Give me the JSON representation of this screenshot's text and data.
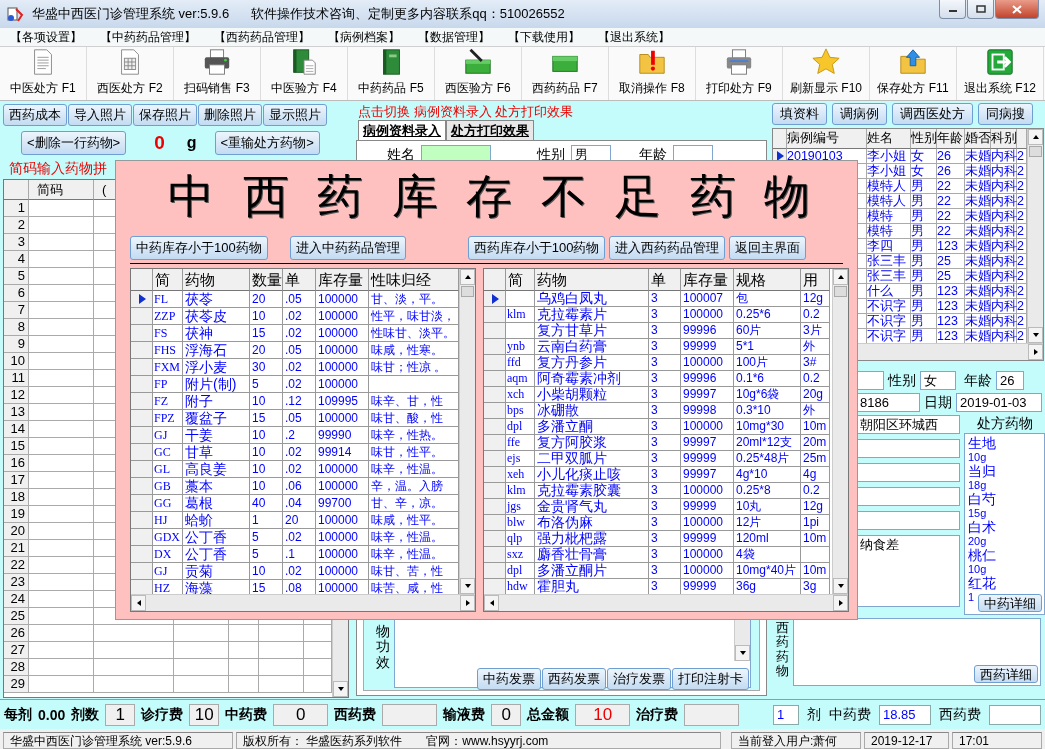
{
  "window": {
    "title": "华盛中西医门诊管理系统 ver:5.9.6",
    "subtitle": "软件操作技术咨询、定制更多内容联系qq：510026552"
  },
  "menu": [
    "【各项设置】",
    "【中药药品管理】",
    "【西药药品管理】",
    "【病例档案】",
    "【数据管理】",
    "【下载使用】",
    "【退出系统】"
  ],
  "toolbar": [
    "中医处方 F1",
    "西医处方 F2",
    "扫码销售 F3",
    "中医验方 F4",
    "中药药品 F5",
    "西医验方 F6",
    "西药药品 F7",
    "取消操作 F8",
    "打印处方 F9",
    "刷新显示 F10",
    "保存处方 F11",
    "退出系统 F12"
  ],
  "left_panel": {
    "photo_buttons": [
      "西药成本",
      "导入照片",
      "保存照片",
      "删除照片",
      "显示照片"
    ],
    "delete_row_button": "<删除一行药物>",
    "weight": "0",
    "weight_unit": "g",
    "reset_button": "<重输处方药物>",
    "hint": "简码输入药物拼",
    "grid": {
      "columns": [
        "简码",
        "("
      ],
      "row_numbers": [
        "1",
        "2",
        "3",
        "4",
        "5",
        "6",
        "7",
        "8",
        "9",
        "10",
        "11",
        "12",
        "13",
        "14",
        "15",
        "16",
        "17",
        "18",
        "19",
        "20",
        "21",
        "22",
        "23",
        "24",
        "25",
        "26",
        "27",
        "28",
        "29"
      ]
    }
  },
  "center_panel": {
    "switch_hint": "点击切换  病例资料录入  处方打印效果",
    "tabs": [
      {
        "label": "病例资料录入",
        "selected": true
      },
      {
        "label": "处方打印效果",
        "selected": false
      }
    ],
    "form": {
      "name_label": "姓名",
      "sex_label": "性别",
      "sex": "男",
      "age_label": "年龄"
    },
    "effect_label": "物功效",
    "invoice_buttons": [
      "中药发票",
      "西药发票",
      "治疗发票",
      "打印注射卡"
    ]
  },
  "right_panel": {
    "buttons": [
      "填资料",
      "调病例",
      "调西医处方",
      "同病搜"
    ],
    "cases": {
      "columns": [
        "病例编号",
        "姓名",
        "性别",
        "年龄",
        "婚否",
        "科别"
      ],
      "rows": [
        {
          "id": "20190103",
          "name": "李小姐",
          "sex": "女",
          "age": "26",
          "marital": "未婚",
          "dept": "内科",
          "column_7": "2",
          "selected": true
        },
        {
          "name": "李小姐",
          "sex": "女",
          "age": "26",
          "marital": "未婚",
          "dept": "内科",
          "column_7": "2"
        },
        {
          "name": "模特人",
          "sex": "男",
          "age": "22",
          "marital": "未婚",
          "dept": "内科",
          "column_7": "2"
        },
        {
          "name": "模特人",
          "sex": "男",
          "age": "22",
          "marital": "未婚",
          "dept": "内科",
          "column_7": "2"
        },
        {
          "name": "模特",
          "sex": "男",
          "age": "22",
          "marital": "未婚",
          "dept": "内科",
          "column_7": "2"
        },
        {
          "name": "模特",
          "sex": "男",
          "age": "22",
          "marital": "未婚",
          "dept": "内科",
          "column_7": "2"
        },
        {
          "name": "李四",
          "sex": "男",
          "age": "123",
          "marital": "未婚",
          "dept": "内科",
          "column_7": "2"
        },
        {
          "name": "张三丰",
          "sex": "男",
          "age": "25",
          "marital": "未婚",
          "dept": "内科",
          "column_7": "2"
        },
        {
          "name": "张三丰",
          "sex": "男",
          "age": "25",
          "marital": "未婚",
          "dept": "内科",
          "column_7": "2"
        },
        {
          "name": "什么",
          "sex": "男",
          "age": "123",
          "marital": "未婚",
          "dept": "内科",
          "column_7": "2"
        },
        {
          "name": "不识字",
          "sex": "男",
          "age": "123",
          "marital": "未婚",
          "dept": "内科",
          "column_7": "2"
        },
        {
          "name": "不识字",
          "sex": "男",
          "age": "123",
          "marital": "未婚",
          "dept": "内科",
          "column_7": "2"
        },
        {
          "name": "不识字",
          "sex": "男",
          "age": "123",
          "marital": "未婚",
          "dept": "内科",
          "column_7": "2"
        }
      ]
    },
    "form": {
      "sex_label": "性别",
      "sex": "女",
      "age_label": "年龄",
      "age": "26",
      "phone": "8186",
      "date_label": "日期",
      "date": "2019-01-03",
      "address": "朝阳区环城西",
      "complaint": "纳食差"
    },
    "prescription": {
      "title": "处方药物",
      "items": [
        {
          "name": "生地",
          "dose": "10g"
        },
        {
          "name": "当归",
          "dose": "18g"
        },
        {
          "name": "白芍",
          "dose": "15g"
        },
        {
          "name": "白术",
          "dose": "20g"
        },
        {
          "name": "桃仁",
          "dose": "10g"
        },
        {
          "name": "红花",
          "dose": "1"
        }
      ],
      "detail_button": "中药详细"
    },
    "western": {
      "label": "西药药物",
      "detail_button": "西药详细"
    }
  },
  "stock_dialog": {
    "title": "中西药库存不足药物",
    "buttons": [
      "中药库存小于100药物",
      "进入中药药品管理",
      "西药库存小于100药物",
      "进入西药药品管理",
      "返回主界面"
    ],
    "herbal_grid": {
      "columns": [
        "简",
        "药物",
        "数量",
        "单",
        "库存量",
        "性味归经"
      ],
      "rows": [
        {
          "code": "FL",
          "name": "茯苓",
          "qty": "20",
          "price": ".05",
          "stock": "100000",
          "properties": "甘、淡，平。",
          "selected": true
        },
        {
          "code": "ZZP",
          "name": "茯苓皮",
          "qty": "10",
          "price": ".02",
          "stock": "100000",
          "properties": "性平，味甘淡，",
          "selected": false
        },
        {
          "code": "FS",
          "name": "茯神",
          "qty": "15",
          "price": ".02",
          "stock": "100000",
          "properties": "性味甘、淡平。",
          "selected": false
        },
        {
          "code": "FHS",
          "name": "浮海石",
          "qty": "20",
          "price": ".05",
          "stock": "100000",
          "properties": "味咸，性寒。",
          "selected": false
        },
        {
          "code": "FXM",
          "name": "浮小麦",
          "qty": "30",
          "price": ".02",
          "stock": "100000",
          "properties": "味甘；性凉 。",
          "selected": false
        },
        {
          "code": "FP",
          "name": "附片(制)",
          "qty": "5",
          "price": ".02",
          "stock": "100000",
          "selected": false
        },
        {
          "code": "FZ",
          "name": "附子",
          "qty": "10",
          "price": ".12",
          "stock": "109995",
          "properties": "味辛、甘，性",
          "selected": false
        },
        {
          "code": "FPZ",
          "name": "覆盆子",
          "qty": "15",
          "price": ".05",
          "stock": "100000",
          "properties": "味甘、酸，性",
          "selected": false
        },
        {
          "code": "GJ",
          "name": "干姜",
          "qty": "10",
          "price": ".2",
          "stock": "99990",
          "properties": "味辛，性热。",
          "selected": false
        },
        {
          "code": "GC",
          "name": "甘草",
          "qty": "10",
          "price": ".02",
          "stock": "99914",
          "properties": "味甘，性平。",
          "selected": false
        },
        {
          "code": "GL",
          "name": "高良姜",
          "qty": "10",
          "price": ".02",
          "stock": "100000",
          "properties": "味辛，性温。",
          "selected": false
        },
        {
          "code": "GB",
          "name": "藁本",
          "qty": "10",
          "price": ".06",
          "stock": "100000",
          "properties": "辛，温。入膀",
          "selected": false
        },
        {
          "code": "GG",
          "name": "葛根",
          "qty": "40",
          "price": ".04",
          "stock": "99700",
          "properties": "甘、辛，凉。",
          "selected": false
        },
        {
          "code": "HJ",
          "name": "蛤蚧",
          "qty": "1",
          "price": "20",
          "stock": "100000",
          "properties": "味咸，性平。",
          "selected": false
        },
        {
          "code": "GDX",
          "name": "公丁香",
          "qty": "5",
          "price": ".02",
          "stock": "100000",
          "properties": "味辛，性温。",
          "selected": false
        },
        {
          "code": "DX",
          "name": "公丁香",
          "qty": "5",
          "price": ".1",
          "stock": "100000",
          "properties": "味辛，性温。",
          "selected": false
        },
        {
          "code": "GJ",
          "name": "贡菊",
          "qty": "10",
          "price": ".02",
          "stock": "100000",
          "properties": "味甘、苦，性",
          "selected": false
        },
        {
          "code": "HZ",
          "name": "海藻",
          "qty": "15",
          "price": ".08",
          "stock": "100000",
          "properties": "味苦、咸，性",
          "selected": false
        }
      ]
    },
    "western_grid": {
      "columns": [
        "简",
        "药物",
        "单",
        "库存量",
        "规格",
        "用"
      ],
      "rows": [
        {
          "name": "乌鸡白凤丸",
          "price": "3",
          "stock": "100007",
          "spec": "包",
          "usage": "12g",
          "selected": true
        },
        {
          "code": "klm",
          "name": "克拉霉素片",
          "price": "3",
          "stock": "100000",
          "spec": "0.25*6",
          "usage": "0.2",
          "selected": false
        },
        {
          "name": "复方甘草片",
          "price": "3",
          "stock": "99996",
          "spec": "60片",
          "usage": "3片",
          "selected": false
        },
        {
          "code": "ynb",
          "name": "云南白药膏",
          "price": "3",
          "stock": "99999",
          "spec": "5*1",
          "usage": "外",
          "selected": false
        },
        {
          "code": "ffd",
          "name": "复方丹参片",
          "price": "3",
          "stock": "100000",
          "spec": "100片",
          "usage": "3#",
          "selected": false
        },
        {
          "code": "aqm",
          "name": "阿奇霉素冲剂",
          "price": "3",
          "stock": "99996",
          "spec": "0.1*6",
          "usage": "0.2",
          "selected": false
        },
        {
          "code": "xch",
          "name": "小柴胡颗粒",
          "price": "3",
          "stock": "99997",
          "spec": "10g*6袋",
          "usage": "20g",
          "selected": false
        },
        {
          "code": "bps",
          "name": "冰硼散",
          "price": "3",
          "stock": "99998",
          "spec": "0.3*10",
          "usage": "外",
          "selected": false
        },
        {
          "code": "dpl",
          "name": "多潘立酮",
          "price": "3",
          "stock": "100000",
          "spec": "10mg*30",
          "usage": "10m",
          "selected": false
        },
        {
          "code": "ffe",
          "name": "复方阿胶浆",
          "price": "3",
          "stock": "99997",
          "spec": "20ml*12支",
          "usage": "20m",
          "selected": false
        },
        {
          "code": "ejs",
          "name": "二甲双胍片",
          "price": "3",
          "stock": "99999",
          "spec": "0.25*48片",
          "usage": "25m",
          "selected": false
        },
        {
          "code": "xeh",
          "name": "小儿化痰止咳",
          "price": "3",
          "stock": "99997",
          "spec": "4g*10",
          "usage": "4g",
          "selected": false
        },
        {
          "code": "klm",
          "name": "克拉霉素胶囊",
          "price": "3",
          "stock": "100000",
          "spec": "0.25*8",
          "usage": "0.2",
          "selected": false
        },
        {
          "code": "jgs",
          "name": "金贵肾气丸",
          "price": "3",
          "stock": "99999",
          "spec": "10丸",
          "usage": "12g",
          "selected": false
        },
        {
          "code": "blw",
          "name": "布洛伪麻",
          "price": "3",
          "stock": "100000",
          "spec": "12片",
          "usage": "1pi",
          "selected": false
        },
        {
          "code": "qlp",
          "name": "强力枇杷露",
          "price": "3",
          "stock": "99999",
          "spec": "120ml",
          "usage": "10m",
          "selected": false
        },
        {
          "code": "sxz",
          "name": "麝香壮骨膏",
          "price": "3",
          "stock": "100000",
          "spec": "4袋",
          "selected": false
        },
        {
          "code": "dpl",
          "name": "多潘立酮片",
          "price": "3",
          "stock": "100000",
          "spec": "10mg*40片",
          "usage": "10m",
          "selected": false
        },
        {
          "code": "hdw",
          "name": "霍胆丸",
          "price": "3",
          "stock": "99999",
          "spec": "36g",
          "usage": "3g",
          "selected": false
        }
      ]
    }
  },
  "totals": [
    {
      "kind": "label",
      "text": "每剂"
    },
    {
      "kind": "value",
      "text": "0.00"
    },
    {
      "kind": "label",
      "text": "剂数"
    },
    {
      "kind": "field",
      "text": "1"
    },
    {
      "kind": "label",
      "text": "诊疗费"
    },
    {
      "kind": "field",
      "text": "10"
    },
    {
      "kind": "label",
      "text": "中药费"
    },
    {
      "kind": "wide_field",
      "text": "0"
    },
    {
      "kind": "label",
      "text": "西药费"
    },
    {
      "kind": "wide_field"
    },
    {
      "kind": "label",
      "text": "输液费"
    },
    {
      "kind": "field",
      "text": "0"
    },
    {
      "kind": "label",
      "text": "总金额"
    },
    {
      "kind": "alert_field",
      "text": "10"
    },
    {
      "kind": "label",
      "text": "治疗费"
    },
    {
      "kind": "wide_field"
    }
  ],
  "totals_right": [
    {
      "kind": "small_field",
      "text": "1"
    },
    {
      "kind": "plain",
      "text": "剂"
    },
    {
      "kind": "plain",
      "text": "中药费"
    },
    {
      "kind": "blue_field",
      "text": "18.85"
    },
    {
      "kind": "plain",
      "text": "西药费"
    },
    {
      "kind": "blue_field"
    }
  ],
  "status_bar": {
    "app": "华盛中西医门诊管理系统 ver:5.9.6",
    "copyright": "版权所有：  华盛医药系列软件",
    "website": "官网：www.hsyyrj.com",
    "user": "当前登入用户:萧何",
    "date": "2019-12-17",
    "time": "17:01"
  }
}
